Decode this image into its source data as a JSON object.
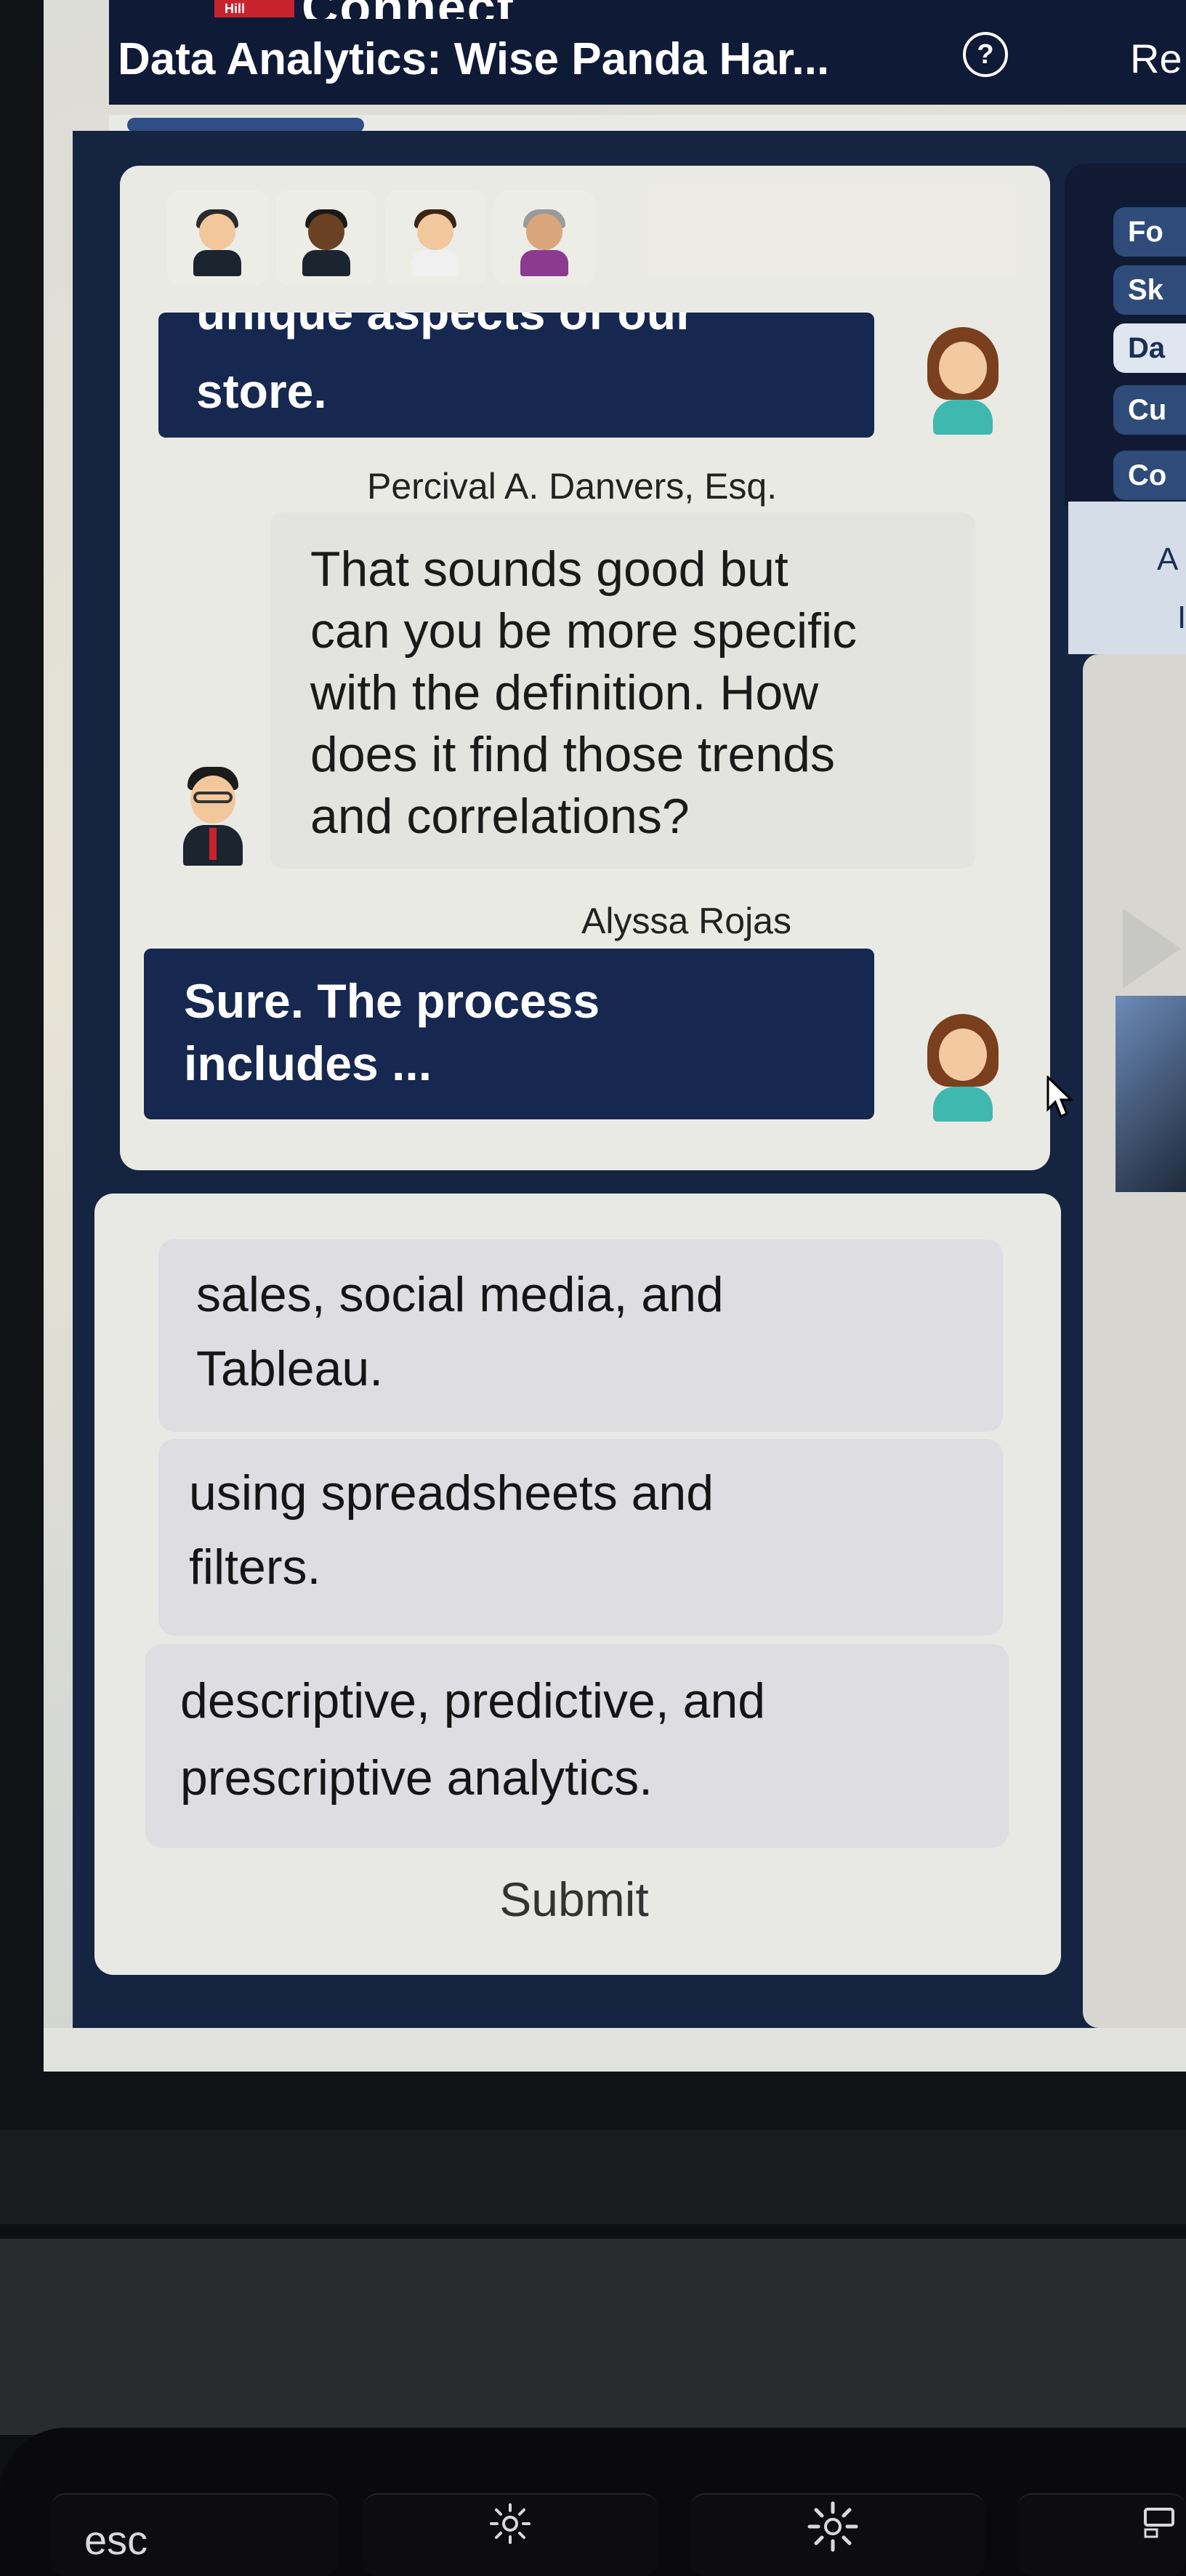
{
  "header": {
    "brand_badge": "Hill",
    "brand_word": "Connect",
    "title": "Data Analytics: Wise Panda Har...",
    "help_symbol": "?",
    "right_label": "Re"
  },
  "progress": {
    "fraction": 0.22
  },
  "chat": {
    "messages": [
      {
        "speaker": "Alyssa Rojas",
        "style": "dark",
        "lines": [
          "unique aspects of our",
          "store."
        ]
      },
      {
        "speaker": "Percival A. Danvers, Esq.",
        "style": "light",
        "lines": [
          "That sounds good but",
          "can you be more specific",
          "with the definition. How",
          "does it find those trends",
          "and correlations?"
        ]
      },
      {
        "speaker": "Alyssa Rojas",
        "style": "dark",
        "lines": [
          "Sure. The process",
          "includes ..."
        ]
      }
    ]
  },
  "options": [
    {
      "lines": [
        "sales, social media, and",
        "Tableau."
      ]
    },
    {
      "lines": [
        "using spreadsheets and",
        "filters."
      ]
    },
    {
      "lines": [
        "descriptive, predictive, and",
        "prescriptive analytics."
      ]
    }
  ],
  "submit_label": "Submit",
  "right_panel": {
    "tabs": [
      "Fo",
      "Sk",
      "Da",
      "Cu",
      "Co"
    ],
    "card_letters": [
      "A",
      "I"
    ]
  },
  "keyboard": {
    "esc_label": "esc",
    "brightness_icon": "brightness-icon"
  },
  "colors": {
    "header_bg": "#0f1a36",
    "dark_bubble": "#162850",
    "accent_blue": "#2f4e86",
    "option_bg": "#dddde2"
  }
}
